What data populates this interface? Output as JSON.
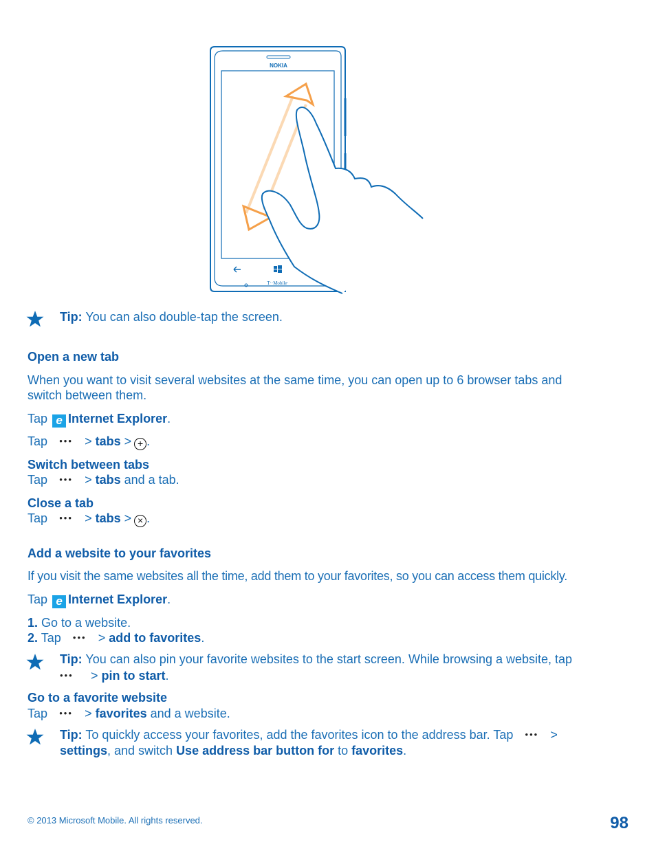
{
  "illustration": {
    "brand": "NOKIA",
    "carrier": "T··Mobile·",
    "description": "phone with two-finger pinch zoom gesture"
  },
  "tip1": {
    "label": "Tip:",
    "text": " You can also double-tap the screen."
  },
  "section_new_tab": {
    "heading": "Open a new tab",
    "para_line1": "When you want to visit several websites at the same time, you can open up to 6 browser tabs and",
    "para_line2": "switch between them.",
    "tap1": {
      "tap": "Tap",
      "app": "Internet Explorer",
      "end": "."
    },
    "tap2": {
      "tap": "Tap",
      "dots": "•••",
      "sep": ">",
      "tabs": "tabs",
      "sep2": ">",
      "end": "."
    }
  },
  "switch_tabs": {
    "heading": "Switch between tabs",
    "tap": "Tap",
    "dots": "•••",
    "sep": ">",
    "tabs": "tabs",
    "rest": " and a tab."
  },
  "close_tab": {
    "heading": "Close a tab",
    "tap": "Tap",
    "dots": "•••",
    "sep": ">",
    "tabs": "tabs",
    "sep2": ">",
    "end": "."
  },
  "section_favorites": {
    "heading": "Add a website to your favorites",
    "para": "If you visit the same websites all the time, add them to your favorites, so you can access them quickly.",
    "tap1": {
      "tap": "Tap",
      "app": "Internet Explorer",
      "end": "."
    },
    "step1": {
      "num": "1.",
      "text": " Go to a website."
    },
    "step2": {
      "num": "2.",
      "tap": " Tap",
      "dots": "•••",
      "sep": ">",
      "action": "add to favorites",
      "end": "."
    }
  },
  "tip2": {
    "label": "Tip:",
    "line1": " You can also pin your favorite websites to the start screen. While browsing a website, tap",
    "dots": "•••",
    "sep": ">",
    "action": "pin to start",
    "end": "."
  },
  "go_favorite": {
    "heading": "Go to a favorite website",
    "tap": "Tap",
    "dots": "•••",
    "sep": ">",
    "action": "favorites",
    "rest": " and a website."
  },
  "tip3": {
    "label": "Tip:",
    "line1": " To quickly access your favorites, add the favorites icon to the address bar. Tap",
    "dots": "•••",
    "sep": ">",
    "settings": "settings",
    "mid1": ", and switch ",
    "option": "Use address bar button for",
    "mid2": " to ",
    "value": "favorites",
    "end": "."
  },
  "footer": {
    "copyright": "© 2013 Microsoft Mobile. All rights reserved.",
    "page": "98"
  },
  "colors": {
    "text": "#1a6eb5",
    "heading": "#0f5ca8",
    "arrow": "#f5a04a",
    "ie_tile": "#1ba3e6"
  }
}
